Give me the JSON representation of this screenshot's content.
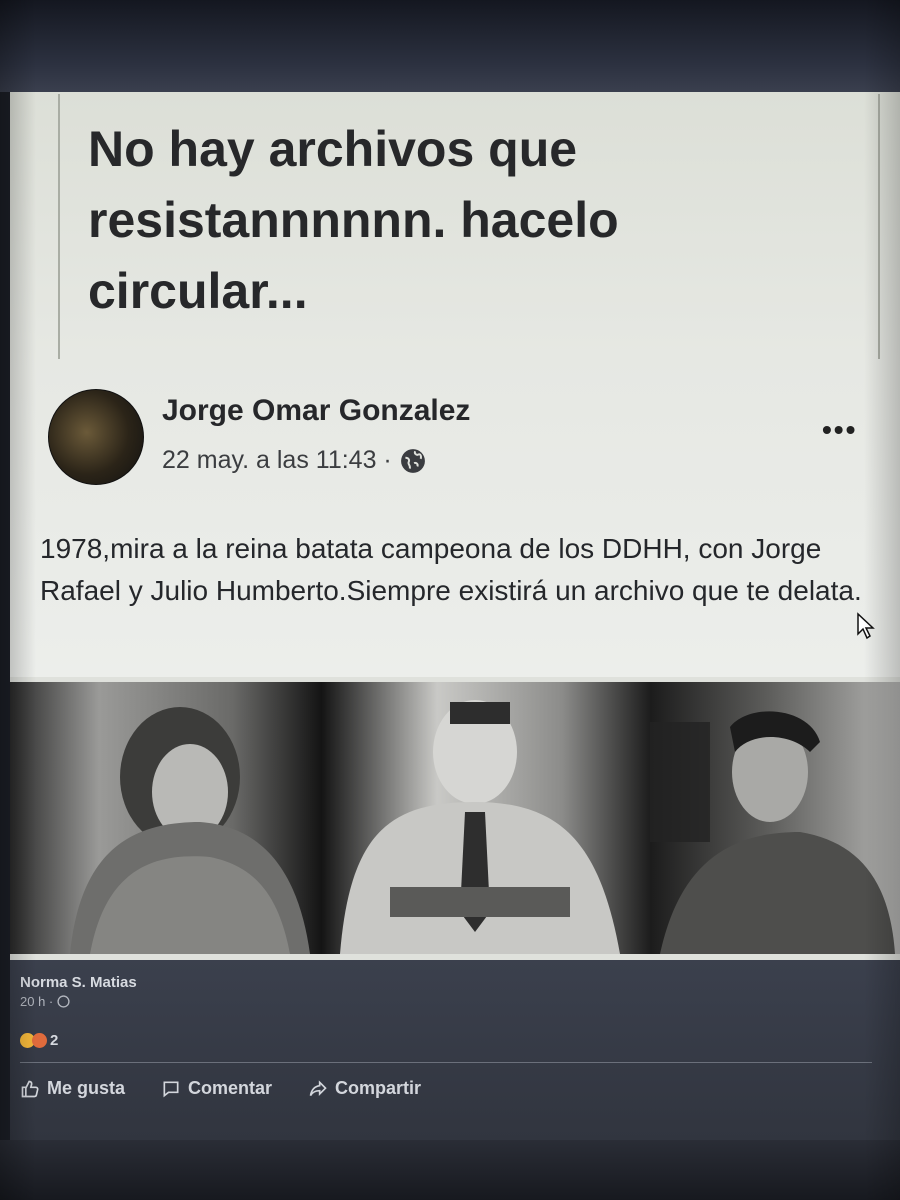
{
  "shared_post": {
    "quote": "No hay archivos que resistannnnnn. hacelo circular..."
  },
  "post": {
    "author": "Jorge Omar Gonzalez",
    "timestamp": "22 may. a las 11:43 ·",
    "privacy_icon": "globe-icon",
    "more_icon": "more-options-icon",
    "text": "1978,mira a la reina batata campeona de los DDHH, con Jorge Rafael y Julio Humberto.Siempre existirá un archivo que te delata."
  },
  "sharer": {
    "name": "Norma S. Matias",
    "time": "20 h ·",
    "reaction_count": "2"
  },
  "actions": {
    "like_label": "Me gusta",
    "comment_label": "Comentar",
    "share_label": "Compartir"
  }
}
